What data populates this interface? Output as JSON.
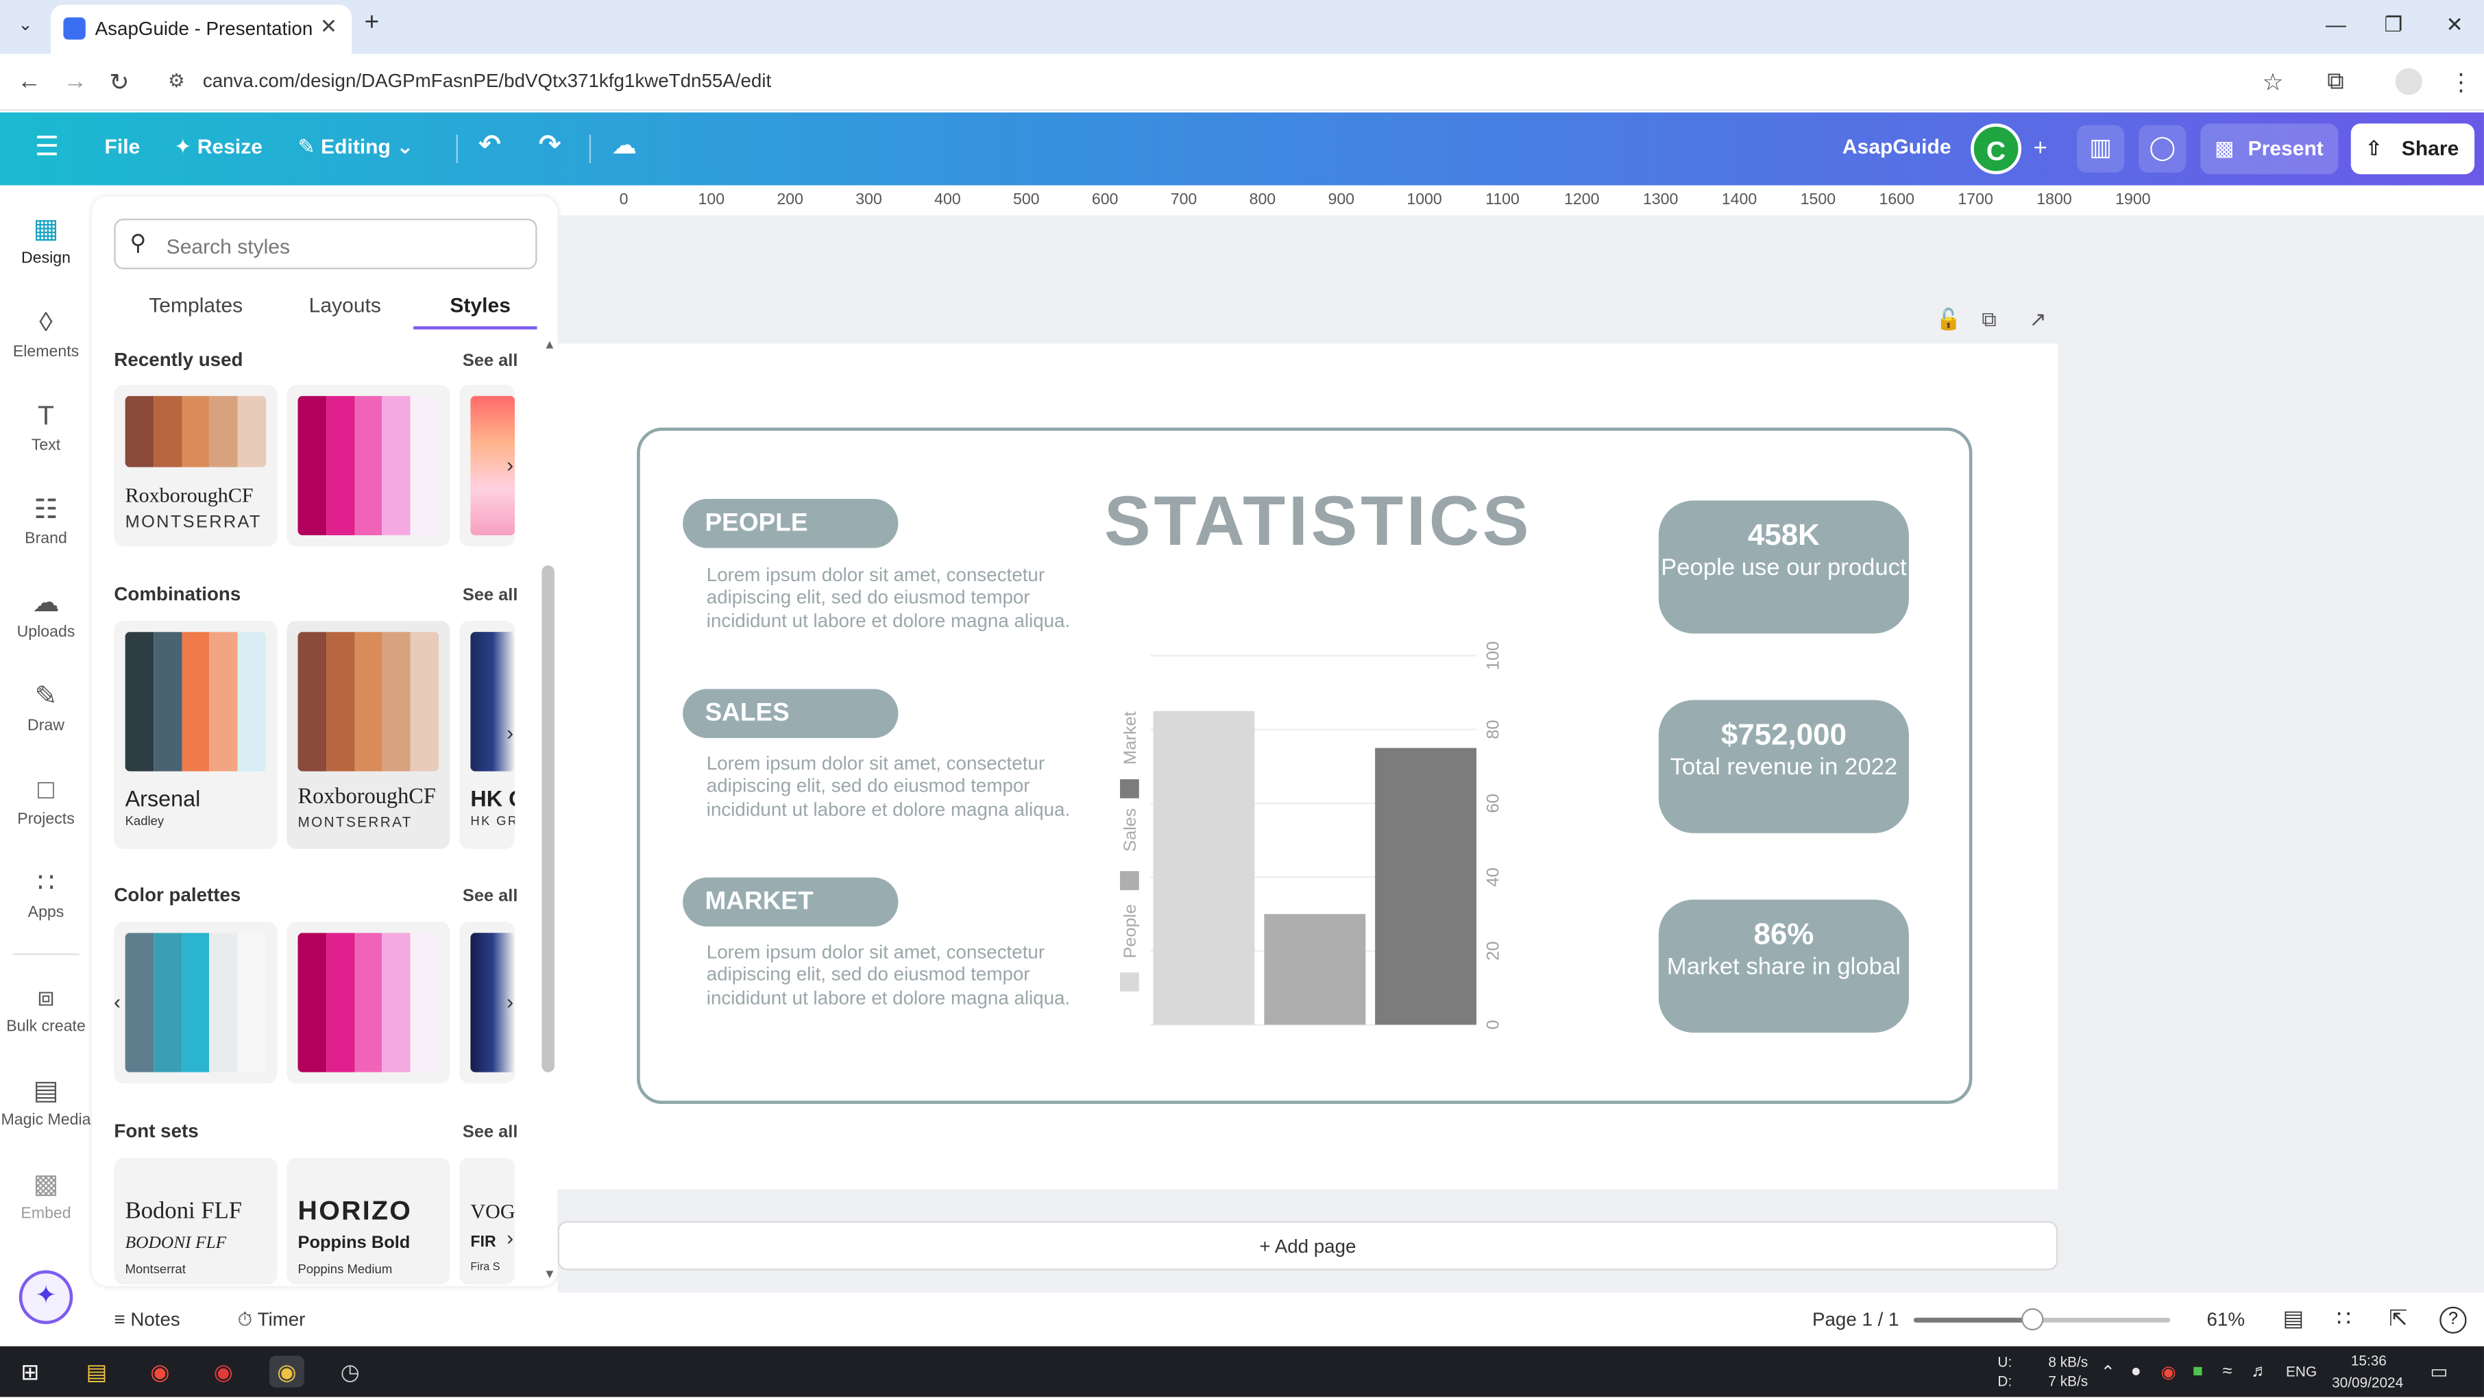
{
  "browser": {
    "tab_title": "AsapGuide - Presentation",
    "url": "canva.com/design/DAGPmFasnPE/bdVQtx371kfg1kweTdn55A/edit"
  },
  "topbar": {
    "file": "File",
    "resize": "Resize",
    "editing": "Editing",
    "brand_name": "AsapGuide",
    "avatar_initial": "C",
    "present": "Present",
    "share": "Share"
  },
  "rail": {
    "design": "Design",
    "elements": "Elements",
    "text": "Text",
    "brand": "Brand",
    "uploads": "Uploads",
    "draw": "Draw",
    "projects": "Projects",
    "apps": "Apps",
    "bulk_create": "Bulk create",
    "magic_media": "Magic Media",
    "embed": "Embed"
  },
  "panel": {
    "search_placeholder": "Search styles",
    "tabs": {
      "templates": "Templates",
      "layouts": "Layouts",
      "styles": "Styles"
    },
    "recently_used": "Recently used",
    "combinations": "Combinations",
    "color_palettes": "Color palettes",
    "font_sets": "Font sets",
    "see_all": "See all",
    "recent_card_font1": "RoxboroughCF",
    "recent_card_font2": "MONTSERRAT",
    "combo_card1_font1": "Arsenal",
    "combo_card1_font2": "Kadley",
    "combo_card2_font1": "RoxboroughCF",
    "combo_card2_font2": "MONTSERRAT",
    "combo_card3_font1": "HK G",
    "combo_card3_font2": "HK GR",
    "fontset1_a": "Bodoni FLF",
    "fontset1_b": "BODONI FLF",
    "fontset1_c": "Montserrat",
    "fontset2_a": "HORIZO",
    "fontset2_b": "Poppins Bold",
    "fontset2_c": "Poppins Medium",
    "fontset3_a": "VOG",
    "fontset3_b": "FIR",
    "fontset3_c": "Fira S"
  },
  "palettes": {
    "recent1": [
      "#8b4a3a",
      "#b8663f",
      "#d98c5a",
      "#d9a27f",
      "#e8cbb8"
    ],
    "recent2": [
      "#b3005c",
      "#e0208c",
      "#f063b8",
      "#f6a9e0",
      "#f8f0f8"
    ],
    "combo1": [
      "#2e3c44",
      "#4a6370",
      "#f07a4a",
      "#f3a482",
      "#d8eef4"
    ],
    "combo2": [
      "#8b4a3a",
      "#b8663f",
      "#d98c5a",
      "#d9a27f",
      "#e8cbb8"
    ],
    "palette1": [
      "#5e7e8e",
      "#3a9fb5",
      "#2bb4cf",
      "#e9ecec",
      "#f7f7f7"
    ],
    "palette2": [
      "#b3005c",
      "#e0208c",
      "#f063b8",
      "#f6a9e0",
      "#f8f0f8"
    ]
  },
  "ruler": [
    "0",
    "100",
    "200",
    "300",
    "400",
    "500",
    "600",
    "700",
    "800",
    "900",
    "1000",
    "1100",
    "1200",
    "1300",
    "1400",
    "1500",
    "1600",
    "1700",
    "1800",
    "1900"
  ],
  "slide": {
    "title": "STATISTICS",
    "people_label": "PEOPLE",
    "sales_label": "SALES",
    "market_label": "MARKET",
    "lorem": "Lorem ipsum dolor sit amet, consectetur adipiscing elit, sed do eiusmod tempor incididunt ut labore et dolore magna aliqua.",
    "stat1_big": "458K",
    "stat1_small": "People use our product",
    "stat2_big": "$752,000",
    "stat2_small": "Total revenue in 2022",
    "stat3_big": "86%",
    "stat3_small": "Market share in global"
  },
  "chart_data": {
    "type": "bar",
    "categories": [
      "People",
      "Sales",
      "Market"
    ],
    "values": [
      85,
      30,
      75
    ],
    "series_colors": [
      "#d9d9d9",
      "#aeaeae",
      "#7c7c7c"
    ],
    "legend": [
      "People",
      "Sales",
      "Market"
    ],
    "ylim": [
      0,
      100
    ],
    "yticks": [
      0,
      20,
      40,
      60,
      80,
      100
    ],
    "orientation": "rotated",
    "grid": true
  },
  "workspace": {
    "add_page": "+ Add page"
  },
  "bottombar": {
    "notes": "Notes",
    "timer": "Timer",
    "page_indicator": "Page 1 / 1",
    "zoom": "61%",
    "zoom_fraction": 0.46
  },
  "taskbar": {
    "net_up_label": "U:",
    "net_down_label": "D:",
    "net_up": "8 kB/s",
    "net_down": "7 kB/s",
    "lang": "ENG",
    "time": "15:36",
    "date": "30/09/2024"
  }
}
